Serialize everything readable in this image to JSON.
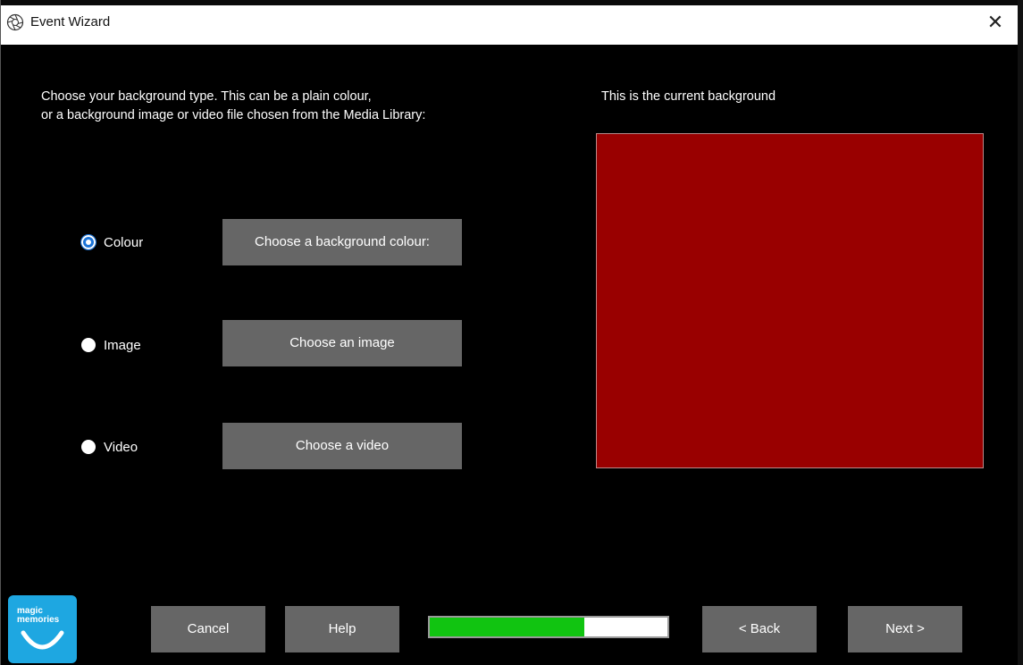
{
  "window": {
    "title": "Event Wizard",
    "close_symbol": "✕",
    "app_icon": "aperture-icon"
  },
  "instructions": {
    "line1": "Choose your background type. This can be a plain colour,",
    "line2": "or a background image or video file chosen from the Media Library:"
  },
  "preview": {
    "label": "This is the current background",
    "color": "#990000"
  },
  "options": [
    {
      "label": "Colour",
      "selected": true,
      "button_label": "Choose a background colour:"
    },
    {
      "label": "Image",
      "selected": false,
      "button_label": "Choose an image"
    },
    {
      "label": "Video",
      "selected": false,
      "button_label": "Choose a video"
    }
  ],
  "footer": {
    "logo_text": "magic\nmemories",
    "cancel_label": "Cancel",
    "help_label": "Help",
    "back_label": "< Back",
    "next_label": "Next >",
    "progress_fraction": 0.65
  },
  "colors": {
    "background": "#000000",
    "button": "#666666",
    "progress_fill": "#11c411",
    "radio_selected": "#1a73d8",
    "logo": "#1ea7e1"
  }
}
